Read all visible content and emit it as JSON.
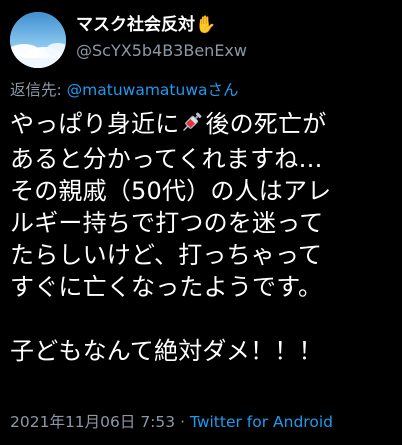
{
  "author": {
    "display_name": "マスク社会反対",
    "display_emoji": "✋",
    "handle": "@ScYX5b4B3BenExw"
  },
  "reply": {
    "prefix": "返信先: ",
    "mention": "@matuwamatuwaさん"
  },
  "tweet": {
    "line1_a": "やっぱり身近に",
    "line1_b": "後の死亡が",
    "line2": "あると分かってくれますね…",
    "line3": "その親戚（50代）の人はアレ",
    "line4": "ルギー持ちで打つのを迷って",
    "line5": "たらしいけど、打っちゃって",
    "line6": "すぐに亡くなったようです。",
    "line7": "子どもなんて絶対ダメ！！！",
    "emoji_icon": "syringe-icon"
  },
  "meta": {
    "timestamp": "2021年11月06日 7:53",
    "separator": " · ",
    "source": "Twitter for Android"
  },
  "colors": {
    "background": "#000000",
    "text": "#ffffff",
    "secondary": "#8b98a5",
    "link": "#1d9bf0"
  }
}
